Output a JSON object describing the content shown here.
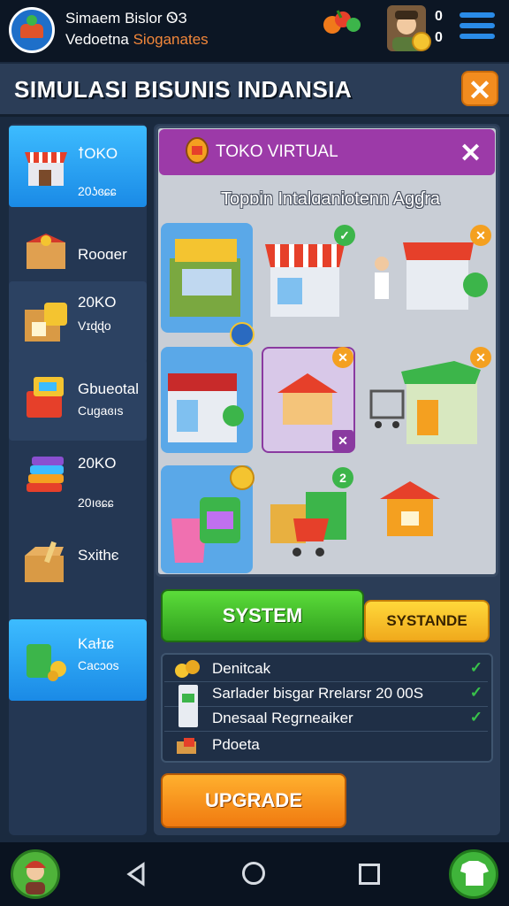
{
  "topbar": {
    "title": "Simaem Bislor ᏫЗ",
    "subtitle_a": "Vedoetna ",
    "subtitle_b": "Sioganates",
    "stat1": "0",
    "stat2": "0"
  },
  "header": {
    "title": "SIMULASI BISUNIS INDANSIA",
    "close_icon": "close-icon"
  },
  "sidebar": {
    "items": [
      {
        "label": "ꝉOKO",
        "sub": "20ʖɞɕɕ",
        "icon": "shop-icon",
        "active": true
      },
      {
        "label": "Rooɑer",
        "sub": "",
        "icon": "gift-box-icon",
        "active": false
      },
      {
        "label": "20KO",
        "sub": "Vɪɖɖo",
        "icon": "box-shop-icon",
        "active": false
      },
      {
        "label": "Gbueotal",
        "sub": "Cugaɞıs",
        "icon": "cash-register-icon",
        "active": false
      },
      {
        "label": "20KO",
        "sub": "20ıɞɕɕ",
        "icon": "stack-icon",
        "active": false
      },
      {
        "label": "Sxithє",
        "sub": "",
        "icon": "parcel-icon",
        "active": false
      },
      {
        "label": "Kaɫɪɕ",
        "sub": "Cacɔos",
        "icon": "money-bag-icon",
        "active": true
      }
    ]
  },
  "panel": {
    "title": "TOKO VIRTUAL",
    "subtitle": "Topɒin Intalɑaniotenn Agɠra",
    "badges": [
      "✓",
      "✕",
      "✕",
      "✕",
      "✕",
      "2"
    ]
  },
  "buttons": {
    "system": "SYSTEM",
    "systande": "SYSTANDE",
    "upgrade": "UPGRADE"
  },
  "list": [
    {
      "text": "Denitcak",
      "check": "✓"
    },
    {
      "text": "Sarlader bisgar Rrelarsr 20 00S",
      "check": "✓"
    },
    {
      "text": "Dnesaal Regrneaiker",
      "check": "✓"
    },
    {
      "text": "Pdoeta",
      "check": ""
    }
  ],
  "colors": {
    "accent_orange": "#f28c1f",
    "panel_purple": "#9c3aa8",
    "sidebar_active": "#2aa6f2",
    "green_button": "#3fb43a"
  }
}
